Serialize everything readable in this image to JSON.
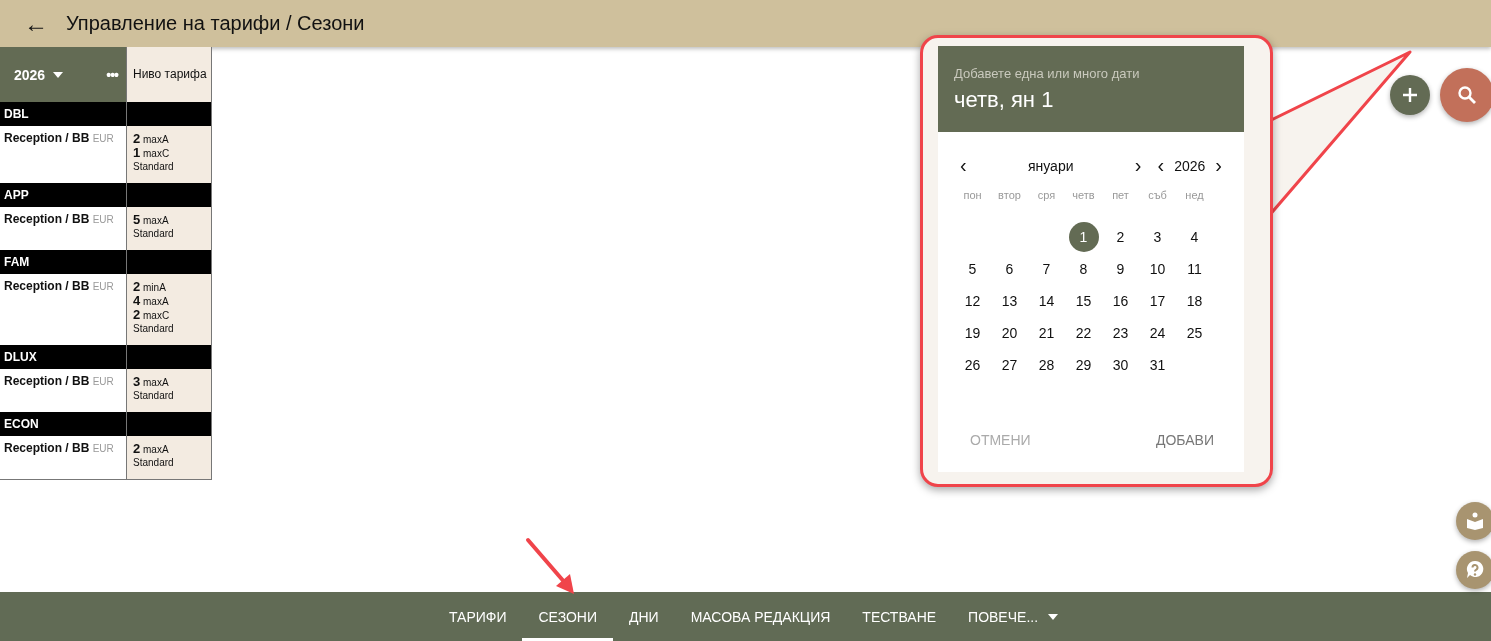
{
  "header": {
    "back": "←",
    "title": "Управление на тарифи / Сезони"
  },
  "table": {
    "year": "2026",
    "more": "•••",
    "level_header": "Ниво тарифа",
    "groups": [
      {
        "code": "DBL",
        "rows": [
          {
            "plan": "Reception / BB",
            "currency": "EUR",
            "limits": [
              {
                "count": "2",
                "label": "maxA"
              },
              {
                "count": "1",
                "label": "maxC"
              }
            ],
            "level": "Standard"
          }
        ]
      },
      {
        "code": "APP",
        "rows": [
          {
            "plan": "Reception / BB",
            "currency": "EUR",
            "limits": [
              {
                "count": "5",
                "label": "maxA"
              }
            ],
            "level": "Standard"
          }
        ]
      },
      {
        "code": "FAM",
        "rows": [
          {
            "plan": "Reception / BB",
            "currency": "EUR",
            "limits": [
              {
                "count": "2",
                "label": "minA"
              },
              {
                "count": "4",
                "label": "maxA"
              },
              {
                "count": "2",
                "label": "maxC"
              }
            ],
            "level": "Standard"
          }
        ]
      },
      {
        "code": "DLUX",
        "rows": [
          {
            "plan": "Reception / BB",
            "currency": "EUR",
            "limits": [
              {
                "count": "3",
                "label": "maxA"
              }
            ],
            "level": "Standard"
          }
        ]
      },
      {
        "code": "ECON",
        "rows": [
          {
            "plan": "Reception / BB",
            "currency": "EUR",
            "limits": [
              {
                "count": "2",
                "label": "maxA"
              }
            ],
            "level": "Standard"
          }
        ]
      }
    ]
  },
  "date_picker": {
    "hint": "Добавете една или много дати",
    "selected_date": "четв, ян 1",
    "month": "януари",
    "year": "2026",
    "prev": "‹",
    "next": "›",
    "weekdays": [
      "пон",
      "втор",
      "сря",
      "четв",
      "пет",
      "съб",
      "нед"
    ],
    "weeks": [
      {
        "right_aligned": true,
        "days": [
          {
            "day": "1",
            "selected": true
          },
          {
            "day": "2",
            "selected": false
          },
          {
            "day": "3",
            "selected": false
          },
          {
            "day": "4",
            "selected": false
          }
        ]
      },
      {
        "days": [
          {
            "day": "5",
            "selected": false
          },
          {
            "day": "6",
            "selected": false
          },
          {
            "day": "7",
            "selected": false
          },
          {
            "day": "8",
            "selected": false
          },
          {
            "day": "9",
            "selected": false
          },
          {
            "day": "10",
            "selected": false
          },
          {
            "day": "11",
            "selected": false
          }
        ]
      },
      {
        "days": [
          {
            "day": "12",
            "selected": false
          },
          {
            "day": "13",
            "selected": false
          },
          {
            "day": "14",
            "selected": false
          },
          {
            "day": "15",
            "selected": false
          },
          {
            "day": "16",
            "selected": false
          },
          {
            "day": "17",
            "selected": false
          },
          {
            "day": "18",
            "selected": false
          }
        ]
      },
      {
        "days": [
          {
            "day": "19",
            "selected": false
          },
          {
            "day": "20",
            "selected": false
          },
          {
            "day": "21",
            "selected": false
          },
          {
            "day": "22",
            "selected": false
          },
          {
            "day": "23",
            "selected": false
          },
          {
            "day": "24",
            "selected": false
          },
          {
            "day": "25",
            "selected": false
          }
        ]
      },
      {
        "right_aligned": false,
        "days": [
          {
            "day": "26",
            "selected": false
          },
          {
            "day": "27",
            "selected": false
          },
          {
            "day": "28",
            "selected": false
          },
          {
            "day": "29",
            "selected": false
          },
          {
            "day": "30",
            "selected": false
          },
          {
            "day": "31",
            "selected": false
          }
        ]
      }
    ],
    "cancel": "ОТМЕНИ",
    "add": "ДОБАВИ"
  },
  "tabs": [
    {
      "label": "ТАРИФИ",
      "selected": false
    },
    {
      "label": "СЕЗОНИ",
      "selected": true
    },
    {
      "label": "ДНИ",
      "selected": false
    },
    {
      "label": "МАСОВА РЕДАКЦИЯ",
      "selected": false
    },
    {
      "label": "ТЕСТВАНЕ",
      "selected": false
    },
    {
      "label": "ПОВЕЧЕ...",
      "selected": false
    }
  ]
}
